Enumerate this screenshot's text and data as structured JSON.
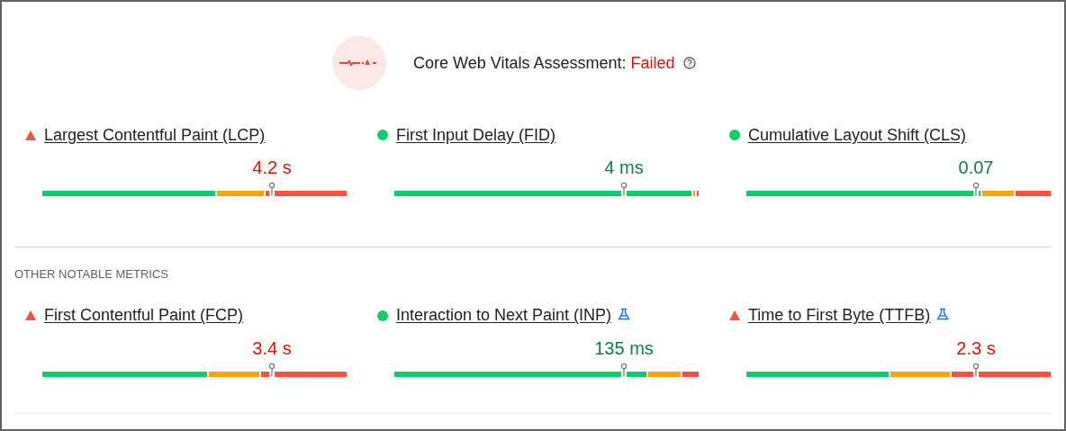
{
  "assessment": {
    "label": "Core Web Vitals Assessment:",
    "result": "Failed"
  },
  "core_metrics": [
    {
      "name": "Largest Contentful Paint (LCP)",
      "kind": "poor",
      "value": "4.2 s"
    },
    {
      "name": "First Input Delay (FID)",
      "kind": "good",
      "value": "4 ms"
    },
    {
      "name": "Cumulative Layout Shift (CLS)",
      "kind": "good",
      "value": "0.07"
    }
  ],
  "other_heading": "OTHER NOTABLE METRICS",
  "other_metrics": [
    {
      "name": "First Contentful Paint (FCP)",
      "kind": "poor",
      "value": "3.4 s"
    },
    {
      "name": "Interaction to Next Paint (INP)",
      "kind": "good",
      "value": "135 ms",
      "experimental": true
    },
    {
      "name": "Time to First Byte (TTFB)",
      "kind": "poor",
      "value": "2.3 s",
      "experimental": true
    }
  ]
}
